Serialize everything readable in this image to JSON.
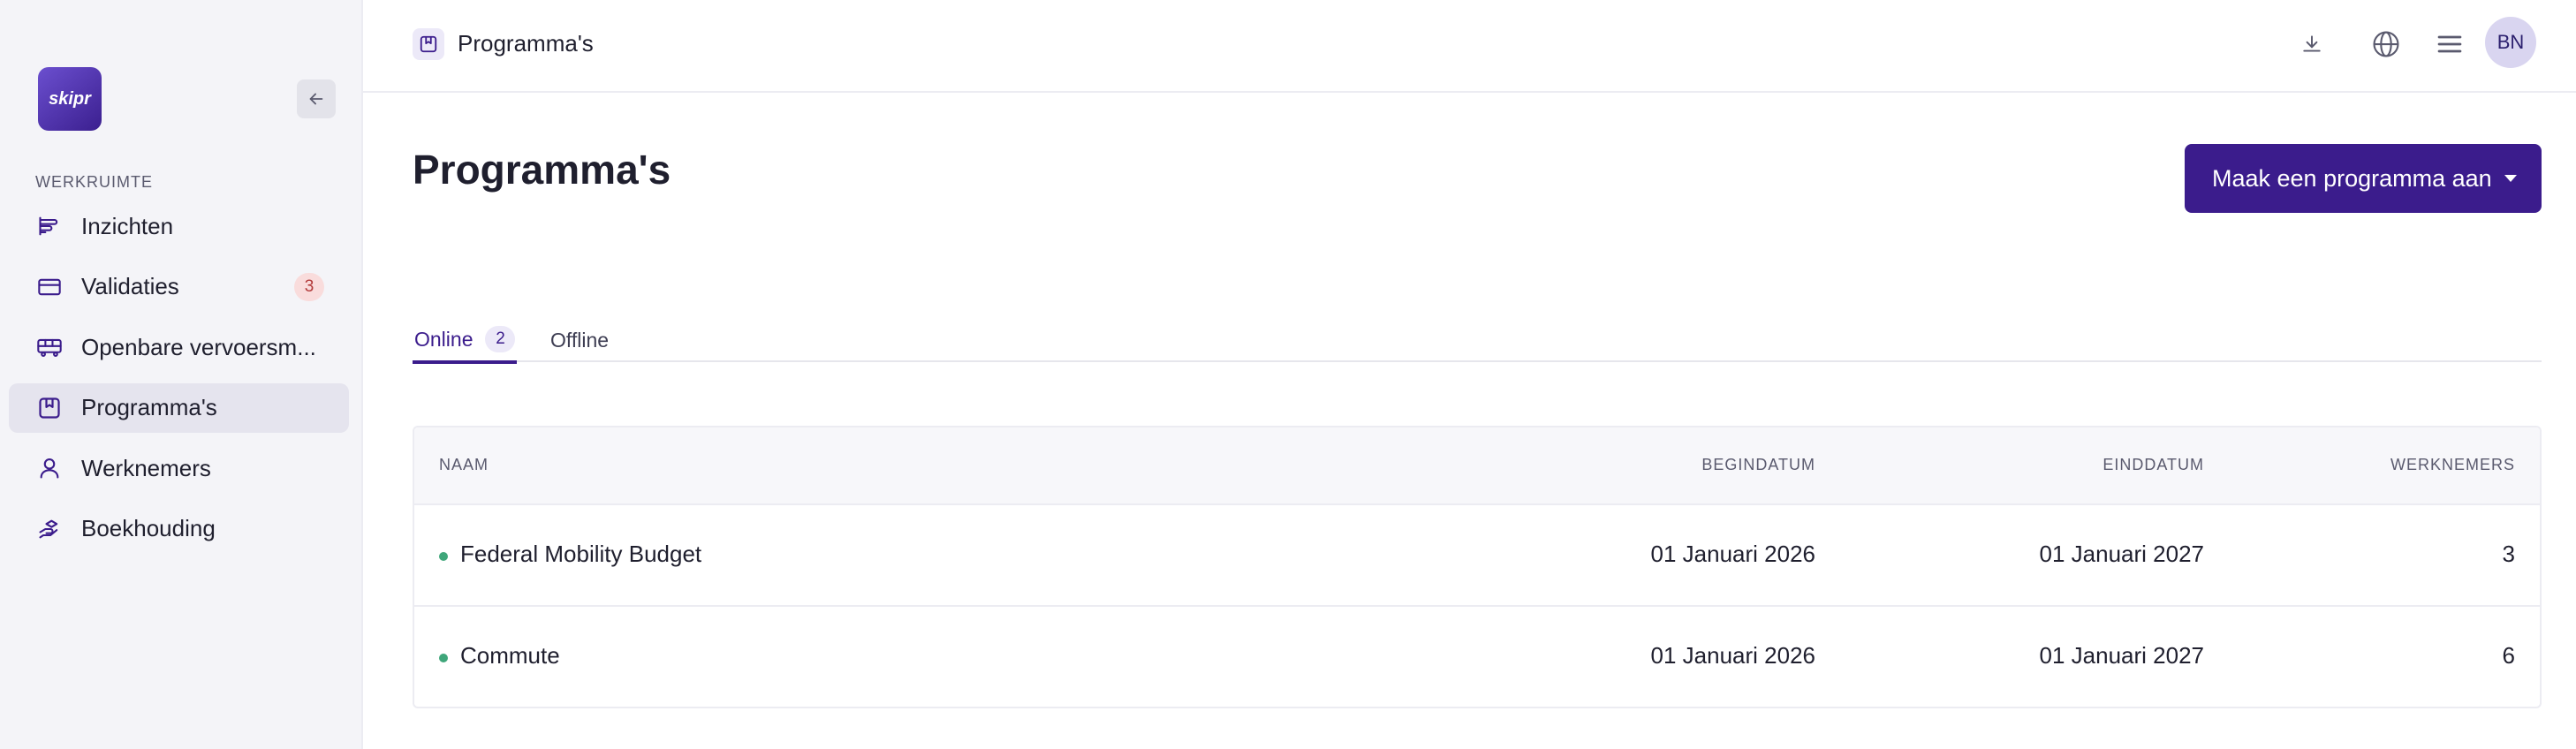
{
  "sidebar": {
    "logo_text": "skipr",
    "section_label": "WERKRUIMTE",
    "items": [
      {
        "label": "Inzichten",
        "icon": "chart-bars-icon"
      },
      {
        "label": "Validaties",
        "icon": "card-icon",
        "badge": "3"
      },
      {
        "label": "Openbare vervoersm...",
        "icon": "bus-icon"
      },
      {
        "label": "Programma's",
        "icon": "bookmark-box-icon",
        "active": true
      },
      {
        "label": "Werknemers",
        "icon": "user-icon"
      },
      {
        "label": "Boekhouding",
        "icon": "hand-coins-icon"
      }
    ]
  },
  "topbar": {
    "title": "Programma's",
    "avatar_initials": "BN",
    "actions": [
      "download-icon",
      "globe-icon",
      "menu-icon"
    ]
  },
  "page": {
    "title": "Programma's",
    "create_button_label": "Maak een programma aan"
  },
  "tabs": [
    {
      "label": "Online",
      "count": "2",
      "active": true
    },
    {
      "label": "Offline",
      "active": false
    }
  ],
  "table": {
    "headers": [
      "NAAM",
      "BEGINDATUM",
      "EINDDATUM",
      "WERKNEMERS"
    ],
    "rows": [
      {
        "name": "Federal Mobility Budget",
        "start": "01 Januari 2026",
        "end": "01 Januari 2027",
        "employees": "3"
      },
      {
        "name": "Commute",
        "start": "01 Januari 2026",
        "end": "01 Januari 2027",
        "employees": "6"
      }
    ]
  },
  "colors": {
    "accent": "#3b1c8c",
    "status_online": "#3fa67a",
    "badge_bg": "#f9dcdc"
  }
}
